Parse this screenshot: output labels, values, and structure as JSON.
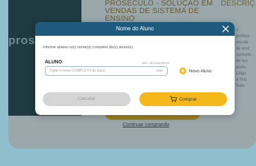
{
  "background": {
    "logo_text": "pros",
    "product_title": "PROSECULO - SOLUÇÃO EM VENDAS DE SISTEMA DE ENSINO",
    "description_heading": "DESCRIÇ",
    "description_lines": [
      "o",
      "profess",
      "escola",
      "de ensi",
      "comunic",
      "de fun",
      "portu",
      "Lingu",
      "a Soc",
      "Natu"
    ],
    "continue_link": "Continuar comprando"
  },
  "modal": {
    "title": "Nome do Aluno",
    "instruction": "Informe abaixo o(s) nome(s) completo do(s) aluno(s).",
    "field_label": "ALUNO",
    "char_limit": "Mín. 15 Caracteres",
    "input_placeholder": "Digite o nome COMPLETO do aluno",
    "input_value": "",
    "input_counter": "0/50",
    "add_student_label": "Novo Aluno",
    "cancel_label": "Cancelar",
    "buy_label": "Comprar"
  },
  "colors": {
    "header": "#1e5a7c",
    "accent": "#f5b81a",
    "cancel_bg": "#d5d5d5"
  },
  "icons": {
    "close": "close-icon",
    "add": "plus-circle-icon",
    "cart": "cart-icon"
  }
}
